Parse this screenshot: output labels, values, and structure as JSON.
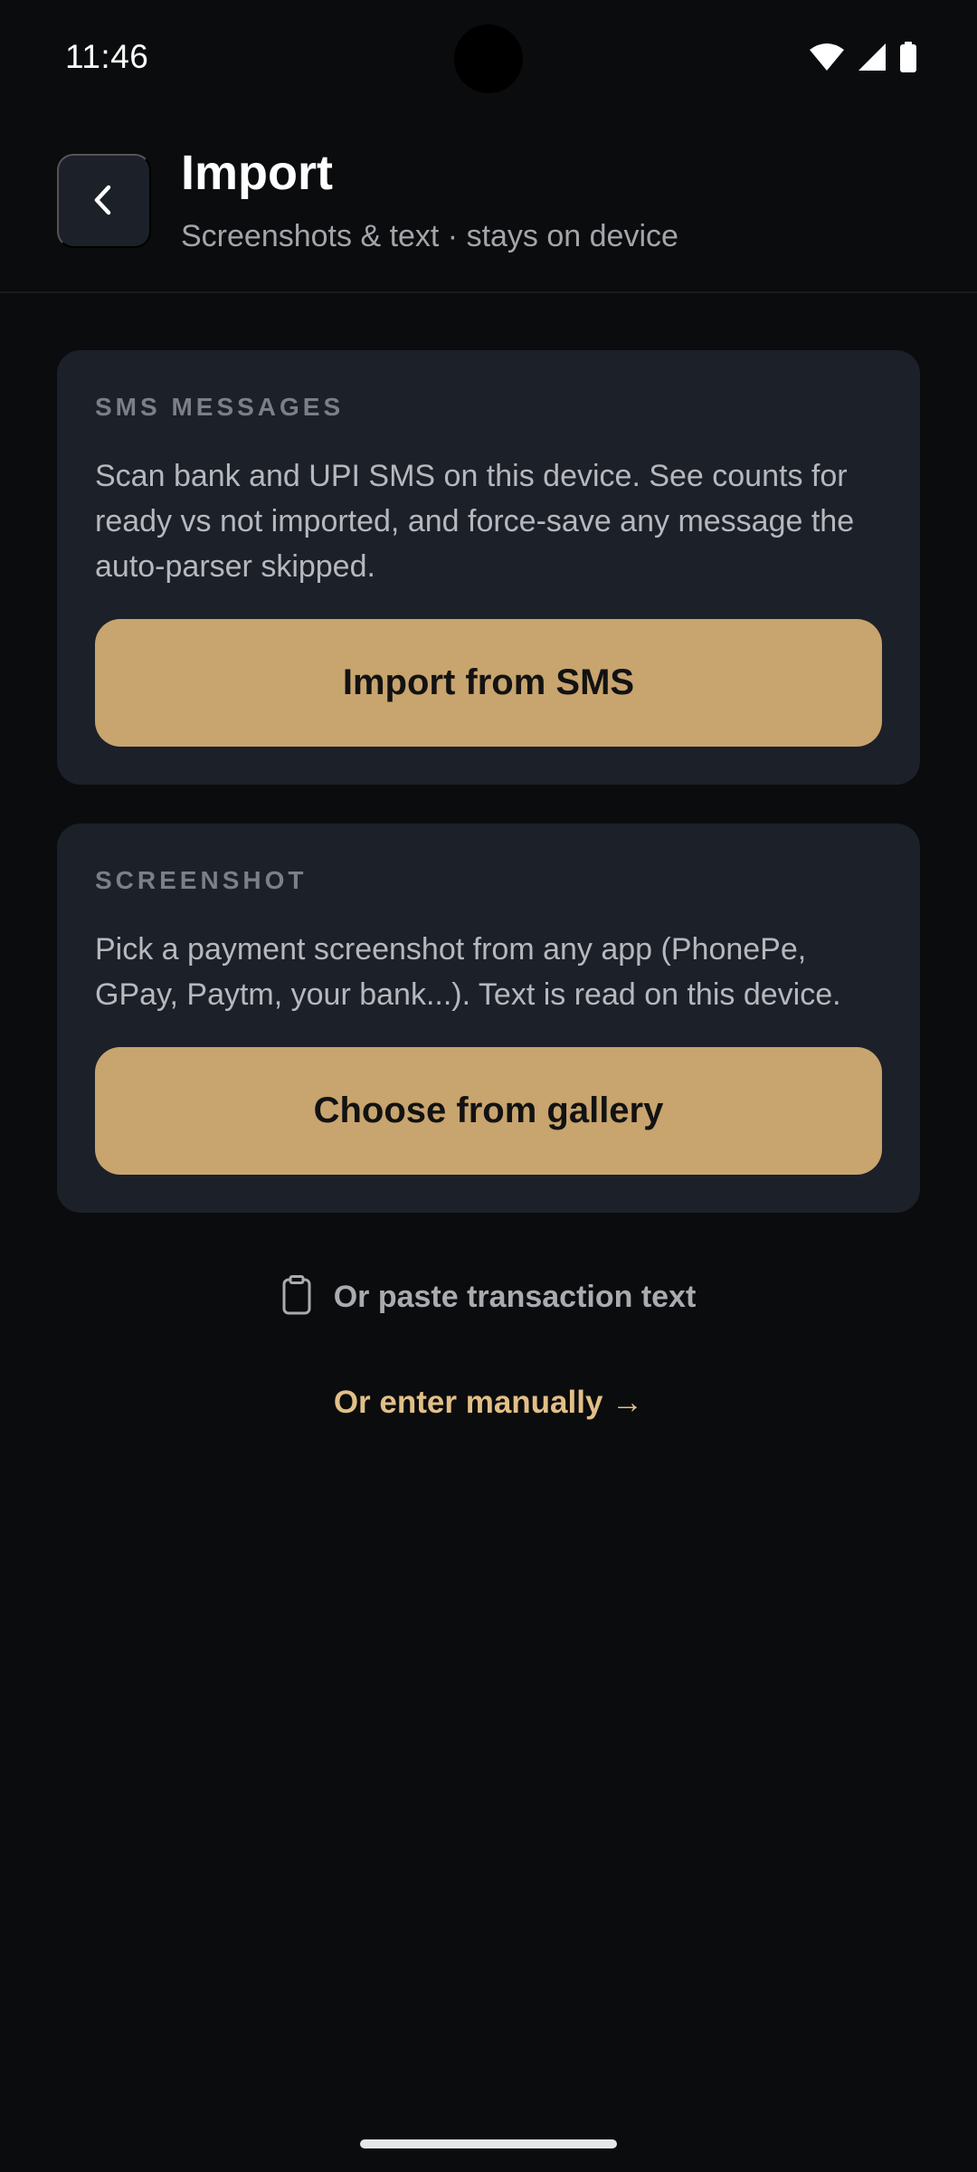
{
  "status_bar": {
    "time": "11:46",
    "icons": [
      "wifi-icon",
      "cellular-signal-icon",
      "battery-icon"
    ]
  },
  "header": {
    "back_icon": "chevron-left-icon",
    "title": "Import",
    "subtitle": "Screenshots & text · stays on device"
  },
  "sms_card": {
    "label": "SMS MESSAGES",
    "description": "Scan bank and UPI SMS on this device. See counts for ready vs not imported, and force-save any message the auto-parser skipped.",
    "button_label": "Import from SMS"
  },
  "screenshot_card": {
    "label": "SCREENSHOT",
    "description": "Pick a payment screenshot from any app (PhonePe, GPay, Paytm, your bank...). Text is read on this device.",
    "button_label": "Choose from gallery"
  },
  "paste": {
    "icon": "clipboard-icon",
    "label": "Or paste transaction text"
  },
  "manual": {
    "label": "Or enter manually →"
  },
  "colors": {
    "background": "#0b0c0e",
    "card": "#1c2029",
    "accent": "#c8a46e",
    "link": "#e2bf86"
  }
}
